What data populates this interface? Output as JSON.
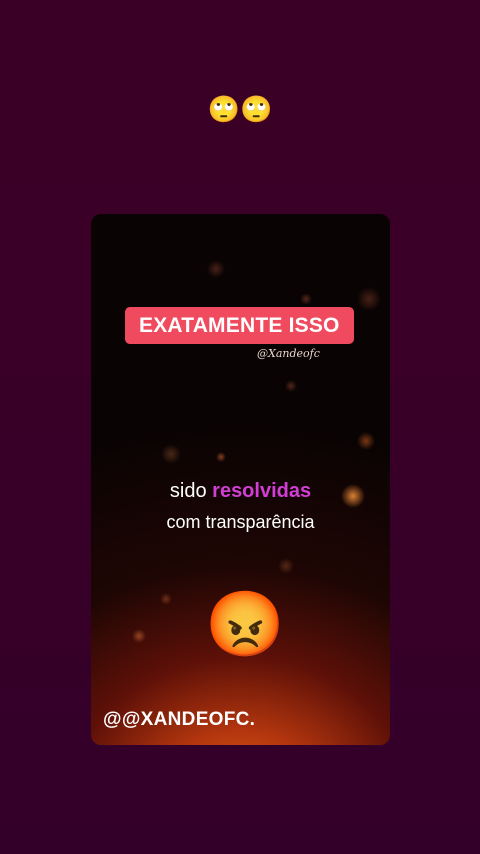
{
  "story": {
    "caption": "🙄🙄"
  },
  "card": {
    "headline": "EXATAMENTE ISSO",
    "watermark": "@Xandeofc",
    "subtitle": {
      "line1_plain": "sido",
      "line1_highlight": "resolvidas",
      "line2": "com transparência"
    },
    "emoji": "😡",
    "handle": "@@XANDEOFC."
  },
  "colors": {
    "background": "#3a0024",
    "headline_bg": "#f04a5e",
    "highlight": "#d23ed5"
  }
}
